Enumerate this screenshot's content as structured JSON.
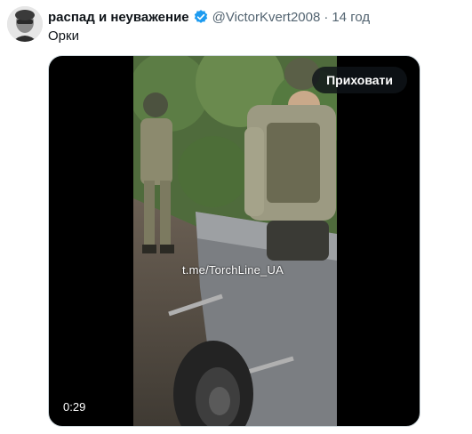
{
  "tweet": {
    "author_name": "распад и неуважение",
    "handle": "@VictorKvert2008",
    "separator": "·",
    "time": "14 год",
    "text": "Орки"
  },
  "media": {
    "hide_label": "Приховати",
    "duration": "0:29",
    "watermark": "t.me/TorchLine_UA"
  },
  "colors": {
    "verified": "#1d9bf0",
    "muted_text": "#536471",
    "overlay_button": "#0f1419"
  },
  "icons": {
    "verified": "verified-badge-icon"
  }
}
